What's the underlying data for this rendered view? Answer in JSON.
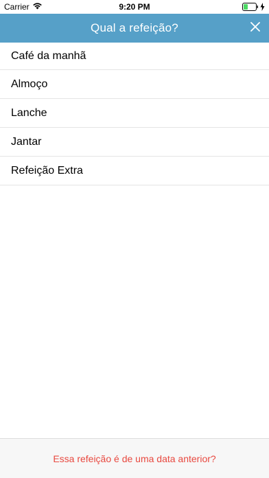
{
  "status_bar": {
    "carrier": "Carrier",
    "time": "9:20 PM",
    "icons": [
      "wifi-icon",
      "battery-icon",
      "charging-icon"
    ]
  },
  "header": {
    "title": "Qual a refeição?",
    "close_icon": "close-icon",
    "background_color": "#56a0c8"
  },
  "meals": [
    {
      "label": "Café da manhã"
    },
    {
      "label": "Almoço"
    },
    {
      "label": "Lanche"
    },
    {
      "label": "Jantar"
    },
    {
      "label": "Refeição Extra"
    }
  ],
  "footer": {
    "link_label": "Essa refeição é de uma data anterior?",
    "link_color": "#e8483f"
  }
}
